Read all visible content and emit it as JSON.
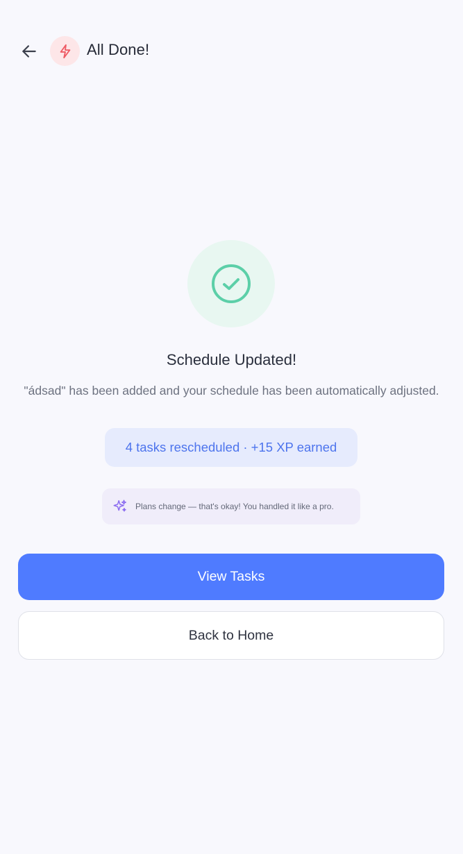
{
  "header": {
    "title": "All Done!",
    "back_icon": "arrow-left-icon",
    "badge_icon": "lightning-bolt-icon",
    "badge_color": "#ee5a64"
  },
  "main": {
    "status_icon": "check-circle-icon",
    "status_color": "#5ccfa8",
    "headline": "Schedule Updated!",
    "description": "\"ádsad\" has been added and your schedule has been automatically adjusted.",
    "stats": "4 tasks rescheduled · +15 XP earned",
    "tip": {
      "icon": "sparkles-icon",
      "text": "Plans change — that's okay! You handled it like a pro."
    }
  },
  "actions": {
    "primary_label": "View Tasks",
    "secondary_label": "Back to Home"
  },
  "colors": {
    "accent": "#4f7bff",
    "background": "#f8f8fd"
  }
}
